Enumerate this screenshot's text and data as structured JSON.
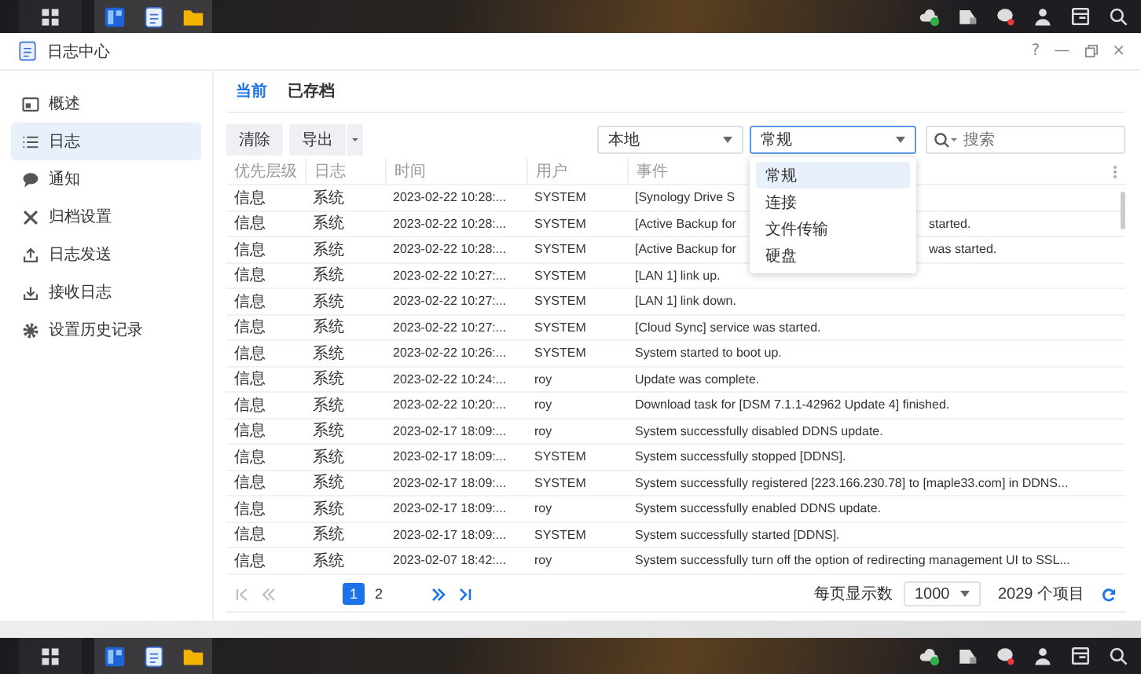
{
  "taskbars": [
    {
      "apps": [
        {
          "kind": "grid"
        },
        {
          "kind": "panel"
        },
        {
          "kind": "notepad"
        },
        {
          "kind": "folder"
        }
      ],
      "tray": [
        {
          "kind": "cloud"
        },
        {
          "kind": "drive"
        },
        {
          "kind": "chat"
        },
        {
          "kind": "user"
        },
        {
          "kind": "widget"
        },
        {
          "kind": "search"
        }
      ]
    },
    {
      "apps": [
        {
          "kind": "grid"
        },
        {
          "kind": "panel"
        },
        {
          "kind": "notepad"
        },
        {
          "kind": "folder"
        }
      ],
      "tray": [
        {
          "kind": "cloud"
        },
        {
          "kind": "drive"
        },
        {
          "kind": "chat"
        },
        {
          "kind": "user"
        },
        {
          "kind": "widget"
        },
        {
          "kind": "search"
        }
      ]
    }
  ],
  "window": {
    "title": "日志中心",
    "controls": [
      "?",
      "—",
      "×"
    ]
  },
  "sidebar": {
    "items": [
      {
        "label": "概述",
        "kind": "overview",
        "selected": false
      },
      {
        "label": "日志",
        "kind": "list",
        "selected": true
      },
      {
        "label": "通知",
        "kind": "notification",
        "selected": false
      },
      {
        "label": "归档设置",
        "kind": "archive",
        "selected": false
      },
      {
        "label": "日志发送",
        "kind": "send",
        "selected": false
      },
      {
        "label": "接收日志",
        "kind": "receive",
        "selected": false
      },
      {
        "label": "设置历史记录",
        "kind": "history",
        "selected": false
      }
    ]
  },
  "tabs": [
    {
      "label": "当前",
      "selected": true
    },
    {
      "label": "已存档",
      "selected": false
    }
  ],
  "toolbar": {
    "clear": "清除",
    "export": "导出",
    "source": "本地",
    "category": "常规",
    "search": {
      "placeholder": "搜索"
    }
  },
  "category_menu": [
    {
      "label": "常规",
      "selected": true
    },
    {
      "label": "连接",
      "selected": false
    },
    {
      "label": "文件传输",
      "selected": false
    },
    {
      "label": "硬盘",
      "selected": false
    }
  ],
  "table": {
    "columns": [
      "优先层级",
      "日志",
      "时间",
      "用户",
      "事件"
    ],
    "rows": [
      {
        "priority": "信息",
        "log": "系统",
        "time": "2023-02-22 10:28:...",
        "user": "SYSTEM",
        "event": "[Synology Drive S"
      },
      {
        "priority": "信息",
        "log": "系统",
        "time": "2023-02-22 10:28:...",
        "user": "SYSTEM",
        "event": "[Active Backup for",
        "event_tail": "started."
      },
      {
        "priority": "信息",
        "log": "系统",
        "time": "2023-02-22 10:28:...",
        "user": "SYSTEM",
        "event": "[Active Backup for",
        "event_tail": "was started."
      },
      {
        "priority": "信息",
        "log": "系统",
        "time": "2023-02-22 10:27:...",
        "user": "SYSTEM",
        "event": "[LAN 1] link up."
      },
      {
        "priority": "信息",
        "log": "系统",
        "time": "2023-02-22 10:27:...",
        "user": "SYSTEM",
        "event": "[LAN 1] link down."
      },
      {
        "priority": "信息",
        "log": "系统",
        "time": "2023-02-22 10:27:...",
        "user": "SYSTEM",
        "event": "[Cloud Sync] service was started."
      },
      {
        "priority": "信息",
        "log": "系统",
        "time": "2023-02-22 10:26:...",
        "user": "SYSTEM",
        "event": "System started to boot up."
      },
      {
        "priority": "信息",
        "log": "系统",
        "time": "2023-02-22 10:24:...",
        "user": "roy",
        "event": "Update was complete."
      },
      {
        "priority": "信息",
        "log": "系统",
        "time": "2023-02-22 10:20:...",
        "user": "roy",
        "event": "Download task for [DSM 7.1.1-42962 Update 4] finished."
      },
      {
        "priority": "信息",
        "log": "系统",
        "time": "2023-02-17 18:09:...",
        "user": "roy",
        "event": "System successfully disabled DDNS update."
      },
      {
        "priority": "信息",
        "log": "系统",
        "time": "2023-02-17 18:09:...",
        "user": "SYSTEM",
        "event": "System successfully stopped [DDNS]."
      },
      {
        "priority": "信息",
        "log": "系统",
        "time": "2023-02-17 18:09:...",
        "user": "SYSTEM",
        "event": "System successfully registered [223.166.230.78] to [maple33.com] in DDNS..."
      },
      {
        "priority": "信息",
        "log": "系统",
        "time": "2023-02-17 18:09:...",
        "user": "roy",
        "event": "System successfully enabled DDNS update."
      },
      {
        "priority": "信息",
        "log": "系统",
        "time": "2023-02-17 18:09:...",
        "user": "SYSTEM",
        "event": "System successfully started [DDNS]."
      },
      {
        "priority": "信息",
        "log": "系统",
        "time": "2023-02-07 18:42:...",
        "user": "roy",
        "event": "System successfully turn off the option of redirecting management UI to SSL..."
      }
    ]
  },
  "pagination": {
    "pages": [
      {
        "label": "1",
        "selected": true
      },
      {
        "label": "2",
        "selected": false
      }
    ],
    "per_page_label": "每页显示数",
    "per_page": "1000",
    "total": "2029 个项目"
  }
}
